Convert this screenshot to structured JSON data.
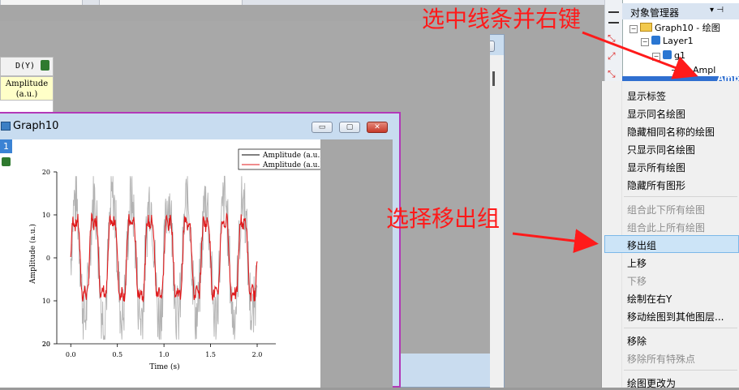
{
  "workbook": {
    "col_header": "D(Y)",
    "long_name_line1": "Amplitude",
    "long_name_line2": "(a.u.)",
    "buttons": [
      "▭",
      "▢",
      "✕"
    ]
  },
  "graph": {
    "title": "Graph10",
    "layer_badge": "1",
    "buttons": [
      "▭",
      "▢",
      "✕"
    ],
    "legend": [
      "Amplitude (a.u.)",
      "Amplitude (a.u.)"
    ]
  },
  "chart_data": {
    "type": "line",
    "xlabel": "Time (s)",
    "ylabel": "Amplitude (a.u.)",
    "xlim": [
      -0.15,
      2.2
    ],
    "ylim": [
      -20,
      20
    ],
    "xticks": [
      "0.0",
      "0.5",
      "1.0",
      "1.5",
      "2.0"
    ],
    "yticks": [
      "20",
      "10",
      "0",
      "10",
      "20",
      "20"
    ],
    "series": [
      {
        "name": "Amplitude (a.u.)",
        "color": "#b0b0b0",
        "role": "noisy signal",
        "x_range": [
          0,
          2.0
        ]
      },
      {
        "name": "Amplitude (a.u.)",
        "color": "#e0191b",
        "role": "smoothed signal",
        "x_range": [
          0,
          2.0
        ]
      }
    ],
    "cycles": 10,
    "amplitude_noisy": 14,
    "amplitude_smooth": 10
  },
  "object_manager": {
    "title": "对象管理器",
    "pin": "▾ ⊣",
    "graph_item": "Graph10 - 绘图",
    "layer_item": "Layer1",
    "group_item": "g1",
    "plot_item": "Ampl",
    "plot_item_selected": "Amp"
  },
  "menu": {
    "items": [
      {
        "label": "显示标签",
        "disabled": false
      },
      {
        "label": "显示同名绘图",
        "disabled": false
      },
      {
        "label": "隐藏相同名称的绘图",
        "disabled": false
      },
      {
        "label": "只显示同名绘图",
        "disabled": false
      },
      {
        "label": "显示所有绘图",
        "disabled": false
      },
      {
        "label": "隐藏所有图形",
        "disabled": false
      },
      {
        "label": "组合此下所有绘图",
        "disabled": true
      },
      {
        "label": "组合此上所有绘图",
        "disabled": true
      },
      {
        "label": "移出组",
        "disabled": false
      },
      {
        "label": "上移",
        "disabled": false
      },
      {
        "label": "下移",
        "disabled": true
      },
      {
        "label": "绘制在右Y",
        "disabled": false
      },
      {
        "label": "移动绘图到其他图层...",
        "disabled": false
      },
      {
        "label": "移除",
        "disabled": false
      },
      {
        "label": "移除所有特殊点",
        "disabled": true
      },
      {
        "label": "绘图更改为",
        "disabled": false
      }
    ]
  },
  "annotations": {
    "top": "选中线条并右键",
    "middle": "选择移出组",
    "color": "#ff1a1a"
  }
}
